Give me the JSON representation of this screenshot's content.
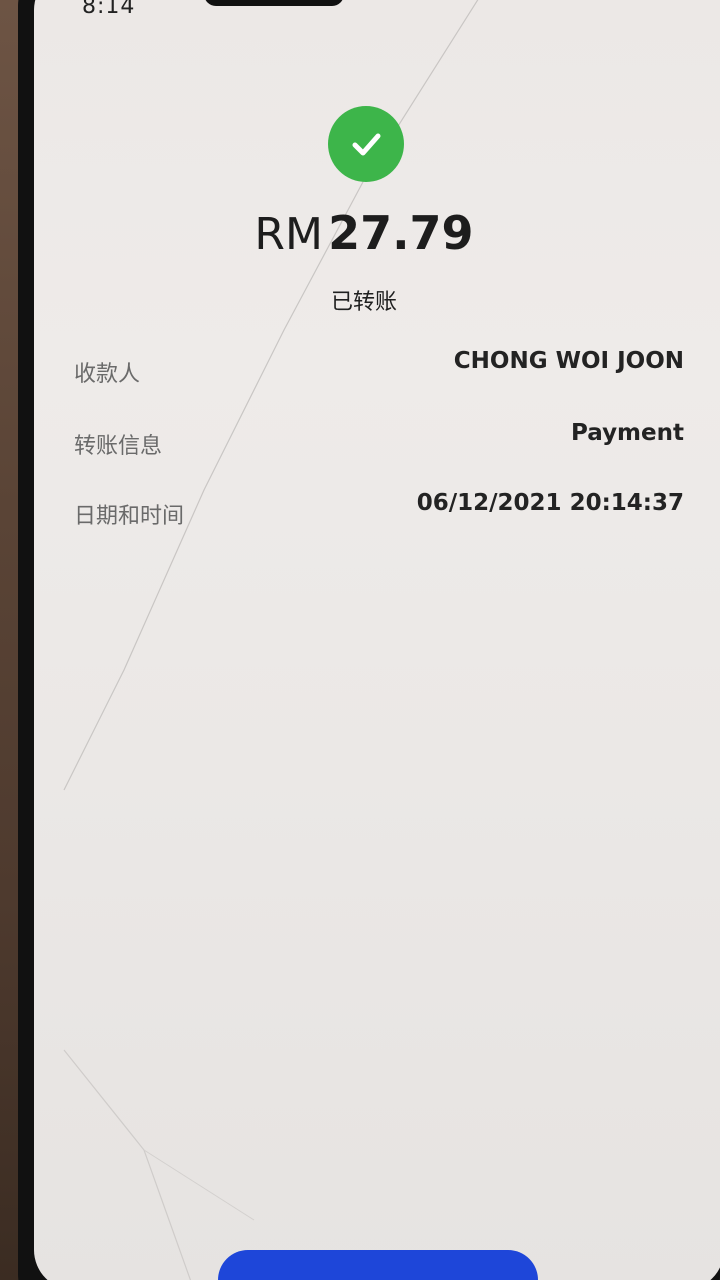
{
  "status_bar": {
    "time": "8:14"
  },
  "receipt": {
    "currency": "RM",
    "amount": "27.79",
    "status": "已转账",
    "rows": [
      {
        "label": "收款人",
        "value": "CHONG WOI JOON"
      },
      {
        "label": "转账信息",
        "value": "Payment"
      },
      {
        "label": "日期和时间",
        "value": "06/12/2021 20:14:37"
      }
    ]
  },
  "colors": {
    "success": "#3db54a",
    "primary_button": "#1e46d9"
  },
  "icons": {
    "status": "check-icon"
  }
}
